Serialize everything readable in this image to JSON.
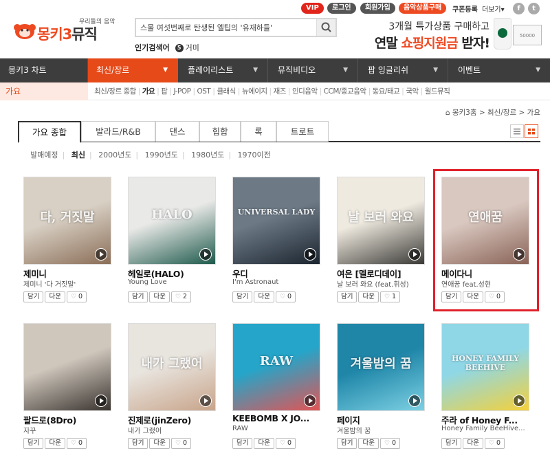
{
  "utility": {
    "vip": "VIP",
    "login": "로그인",
    "join": "회원가입",
    "buy_music": "음악상품구매",
    "coupon": "쿠폰등록",
    "more": "더보기"
  },
  "logo": {
    "tagline": "우리들의 음악",
    "name_prefix": "몽키3",
    "name_suffix": "뮤직"
  },
  "search": {
    "value": "스물 여섯번째로 탄생된 엘팁의 '유재하들'",
    "popular_label": "인기검색어",
    "popular_rank": "5",
    "popular_keyword": "거미"
  },
  "ad": {
    "line1": "3개월 특가상품 구매하고",
    "line2_prefix": "연말",
    "line2_highlight": "쇼핑지원금",
    "line2_suffix": "받자!",
    "card_text": "50000"
  },
  "nav": [
    {
      "label": "몽키3 차트"
    },
    {
      "label": "최신/장르"
    },
    {
      "label": "플레이리스트"
    },
    {
      "label": "뮤직비디오"
    },
    {
      "label": "팝 잉글리쉬"
    },
    {
      "label": "이벤트"
    }
  ],
  "subnav": {
    "category": "가요",
    "links": [
      "최신/장르 종합",
      "가요",
      "팝",
      "J-POP",
      "OST",
      "클래식",
      "뉴에이지",
      "재즈",
      "인디음악",
      "CCM/종교음악",
      "동요/태교",
      "국악",
      "월드뮤직"
    ],
    "active": "가요"
  },
  "breadcrumb": {
    "home": "몽키3홈",
    "level1": "최신/장르",
    "level2": "가요"
  },
  "tabs": [
    "가요 종합",
    "발라드/R&B",
    "댄스",
    "힙합",
    "록",
    "트로트"
  ],
  "filters": [
    "발매예정",
    "최신",
    "2000년도",
    "1990년도",
    "1980년도",
    "1970이전"
  ],
  "buttons": {
    "save": "담기",
    "download": "다운"
  },
  "albums": [
    {
      "title": "제미니",
      "artist": "제미니 '다 거짓말'",
      "likes": "0",
      "cover_text": "다, 거짓말",
      "colors": [
        "#d8d0c4",
        "#8b6e58"
      ]
    },
    {
      "title": "헤일로(HALO)",
      "artist": "Young Love",
      "likes": "2",
      "cover_text": "HALO",
      "colors": [
        "#e9e9e7",
        "#1f5a4c"
      ]
    },
    {
      "title": "우디",
      "artist": "I'm Astronaut",
      "likes": "0",
      "cover_text": "UNIVERSAL LADY",
      "colors": [
        "#6d7a86",
        "#1b2530"
      ]
    },
    {
      "title": "여은 [멜로디데이]",
      "artist": "날 보러 와요 (feat.휘성)",
      "likes": "1",
      "cover_text": "날 보러 와요",
      "colors": [
        "#efeae0",
        "#3b3a36"
      ]
    },
    {
      "title": "메이다니",
      "artist": "연애꿈 feat.성현",
      "likes": "0",
      "cover_text": "연애꿈",
      "colors": [
        "#d9c8c0",
        "#8a6357"
      ]
    },
    {
      "title": "팔드로(8Dro)",
      "artist": "자꾸",
      "likes": "0",
      "cover_text": "",
      "colors": [
        "#cfc7bc",
        "#3a3430"
      ]
    },
    {
      "title": "진제로(jinZero)",
      "artist": "내가 그랬어",
      "likes": "0",
      "cover_text": "내가 그랬어",
      "colors": [
        "#e8e4de",
        "#c8a48a"
      ]
    },
    {
      "title": "KEEBOMB X JO...",
      "artist": "RAW",
      "likes": "0",
      "cover_text": "RAW",
      "colors": [
        "#25a5c9",
        "#e25454"
      ]
    },
    {
      "title": "페이지",
      "artist": "겨울밤의 꿈",
      "likes": "0",
      "cover_text": "겨울밤의 꿈",
      "colors": [
        "#1f86a8",
        "#7cd0e3"
      ]
    },
    {
      "title": "주라 of Honey F...",
      "artist": "Honey Family BeeHive...",
      "likes": "0",
      "cover_text": "HONEY FAMILY BEEHIVE",
      "colors": [
        "#8fd7e6",
        "#f4d13a"
      ]
    }
  ],
  "colors": {
    "accent": "#e64a19",
    "nav_bg": "#3d3d3d",
    "highlight": "#e0202a"
  }
}
